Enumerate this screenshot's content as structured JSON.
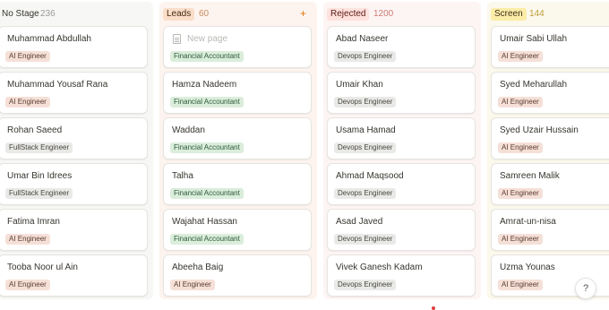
{
  "columns": [
    {
      "title": "No Stage",
      "count": "236",
      "cards": [
        {
          "name": "Muhammad Abdullah",
          "tag": "AI Engineer"
        },
        {
          "name": "Muhammad Yousaf Rana",
          "tag": "AI Engineer"
        },
        {
          "name": "Rohan Saeed",
          "tag": "FullStack Engineer"
        },
        {
          "name": "Umar Bin Idrees",
          "tag": "FullStack Engineer"
        },
        {
          "name": "Fatima Imran",
          "tag": "AI Engineer"
        },
        {
          "name": "Tooba Noor ul Ain",
          "tag": "AI Engineer"
        }
      ]
    },
    {
      "title": "Leads",
      "count": "60",
      "add_icon": "+",
      "new_page_label": "New page",
      "new_page_tag": "Financial Accountant",
      "cards": [
        {
          "name": "Hamza Nadeem",
          "tag": "Financial Accountant"
        },
        {
          "name": "Waddan",
          "tag": "Financial Accountant"
        },
        {
          "name": "Talha",
          "tag": "Financial Accountant"
        },
        {
          "name": "Wajahat Hassan",
          "tag": "Financial Accountant"
        },
        {
          "name": "Abeeha Baig",
          "tag": "AI Engineer"
        }
      ]
    },
    {
      "title": "Rejected",
      "count": "1200",
      "cards": [
        {
          "name": "Abad Naseer",
          "tag": "Devops Engineer"
        },
        {
          "name": "Umair Khan",
          "tag": "Devops Engineer"
        },
        {
          "name": "Usama Hamad",
          "tag": "Devops Engineer"
        },
        {
          "name": "Ahmad Maqsood",
          "tag": "Devops Engineer"
        },
        {
          "name": "Asad Javed",
          "tag": "Devops Engineer"
        },
        {
          "name": "Vivek Ganesh Kadam",
          "tag": "Devops Engineer"
        }
      ]
    },
    {
      "title": "Screen",
      "count": "144",
      "cards": [
        {
          "name": "Umair Sabi Ullah",
          "tag": "AI Engineer"
        },
        {
          "name": "Syed Meharullah",
          "tag": "AI Engineer"
        },
        {
          "name": "Syed Uzair Hussain",
          "tag": "AI Engineer"
        },
        {
          "name": "Samreen Malik",
          "tag": "AI Engineer"
        },
        {
          "name": "Amrat-un-nisa",
          "tag": "AI Engineer"
        },
        {
          "name": "Uzma Younas",
          "tag": "AI Engineer"
        }
      ]
    }
  ],
  "help_label": "?",
  "colors": {
    "leads_accent": "#d9730d",
    "rejected_accent": "#e03e3e",
    "screen_accent": "#dfab01"
  }
}
